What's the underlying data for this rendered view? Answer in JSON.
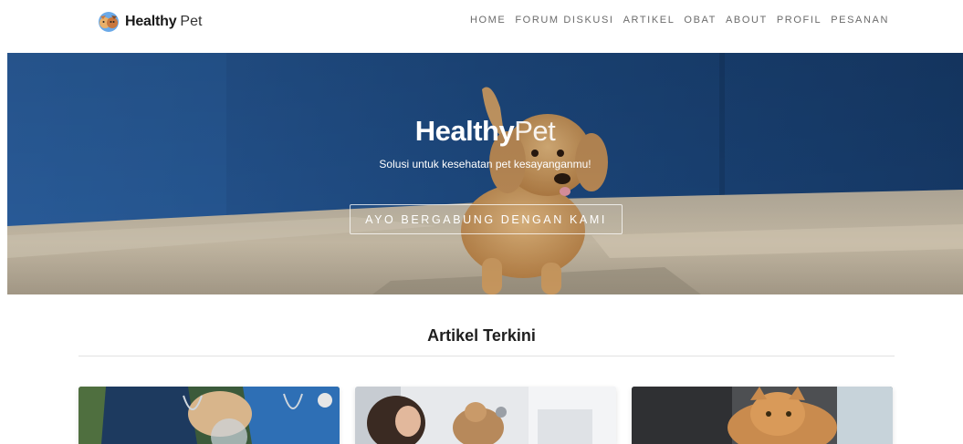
{
  "brand": {
    "name_strong": "Healthy",
    "name_light": "Pet",
    "logo_icon": "pet-logo-icon"
  },
  "nav": {
    "items": [
      {
        "label": "HOME"
      },
      {
        "label": "FORUM DISKUSI"
      },
      {
        "label": "ARTIKEL"
      },
      {
        "label": "OBAT"
      },
      {
        "label": "ABOUT"
      },
      {
        "label": "PROFIL"
      },
      {
        "label": "PESANAN"
      }
    ]
  },
  "hero": {
    "title_strong": "Healthy",
    "title_light": "Pet",
    "subtitle": "Solusi untuk kesehatan pet kesayanganmu!",
    "cta_label": "AYO BERGABUNG DENGAN KAMI",
    "image": "puppy-running-photo"
  },
  "articles": {
    "heading": "Artikel Terkini",
    "cards": [
      {
        "image": "vets-examining-pet-photo"
      },
      {
        "image": "woman-with-cat-photo"
      },
      {
        "image": "orange-cat-photo"
      }
    ]
  },
  "colors": {
    "nav_text": "#6b6b6b",
    "hero_wall": "#1f4e86",
    "hero_floor": "#cdbfa9",
    "puppy": "#d4a46b"
  }
}
